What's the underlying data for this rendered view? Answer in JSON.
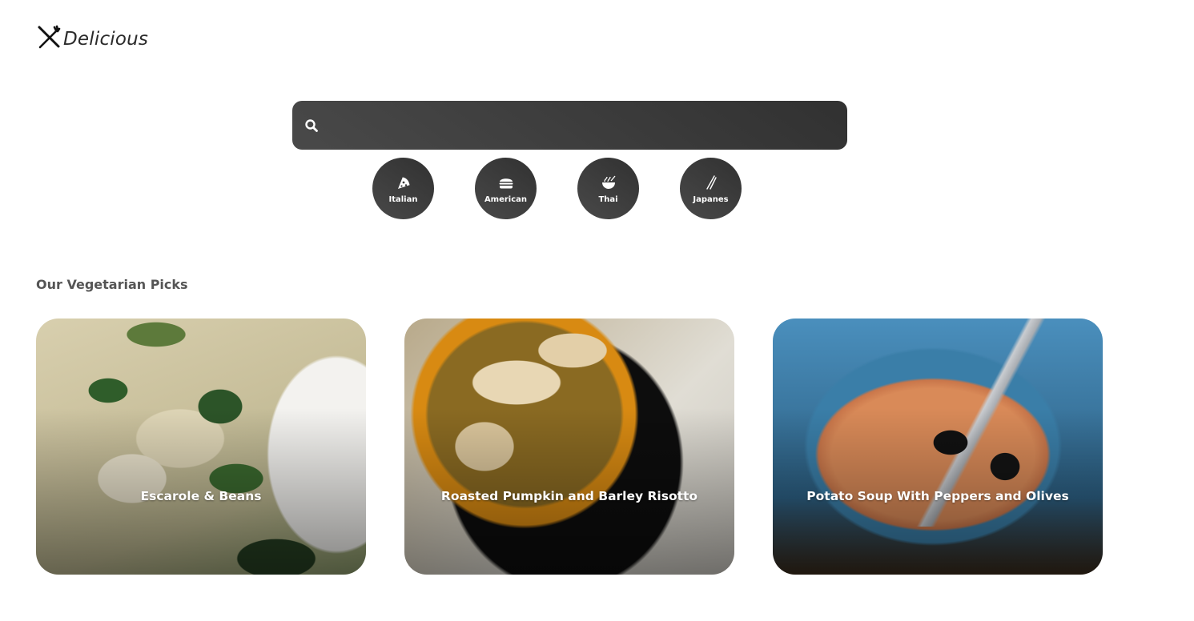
{
  "logo": {
    "text": "Delicious",
    "icon": "fork-knife-icon"
  },
  "search": {
    "placeholder": "",
    "value": "",
    "icon": "search-icon"
  },
  "categories": [
    {
      "label": "Italian",
      "icon": "pizza-icon"
    },
    {
      "label": "American",
      "icon": "hamburger-icon"
    },
    {
      "label": "Thai",
      "icon": "noodle-bowl-icon"
    },
    {
      "label": "Japanes",
      "icon": "chopsticks-icon"
    }
  ],
  "section": {
    "title": "Our Vegetarian Picks"
  },
  "recipes": [
    {
      "title": "Escarole & Beans"
    },
    {
      "title": "Roasted Pumpkin and Barley Risotto"
    },
    {
      "title": "Potato Soup With Peppers and Olives"
    }
  ],
  "colors": {
    "accent": "#3d3d3d",
    "text": "#555555",
    "background": "#ffffff"
  }
}
